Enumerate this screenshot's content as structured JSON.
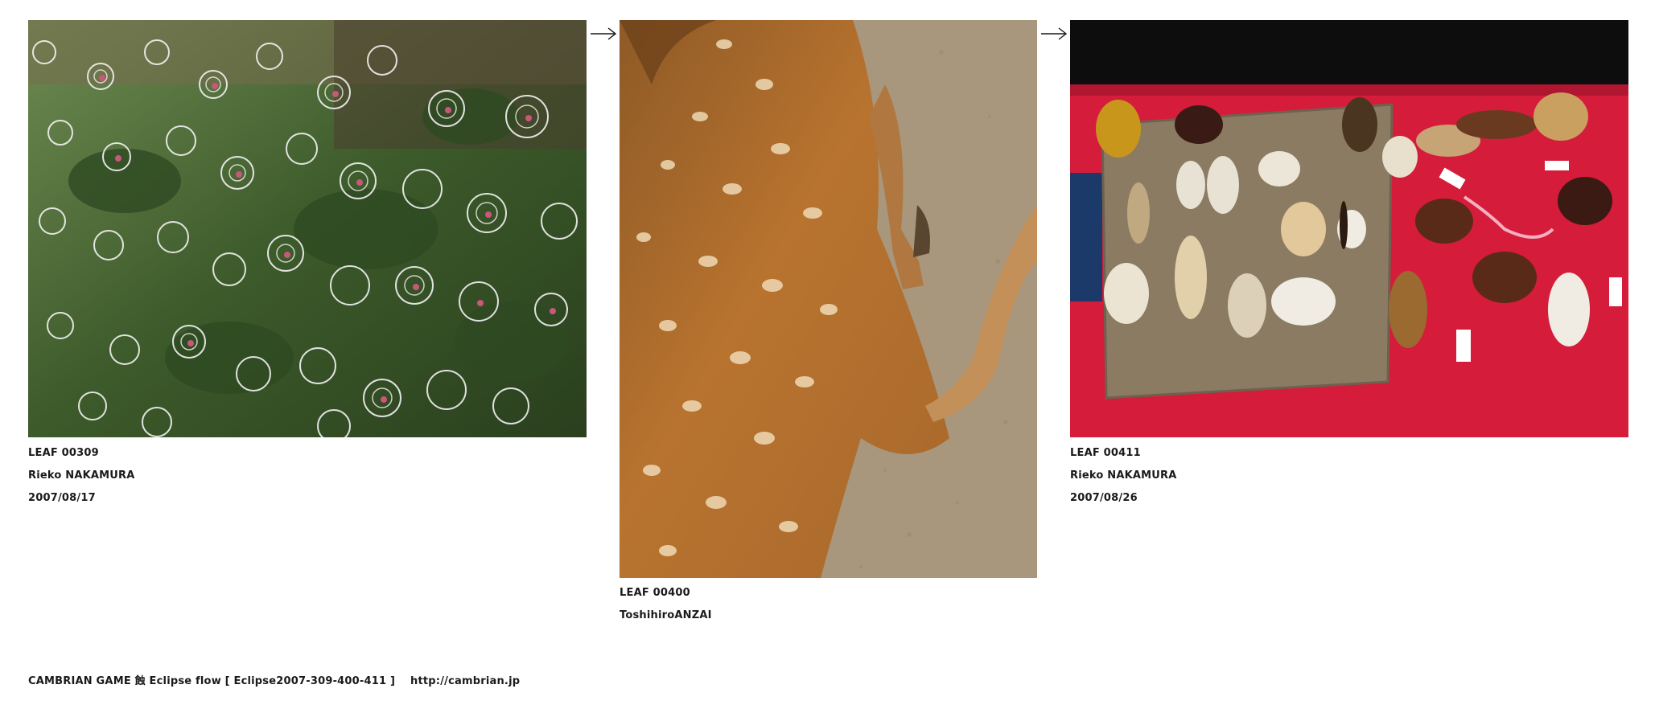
{
  "leaves": [
    {
      "id": "LEAF 00309",
      "author": "Rieko NAKAMURA",
      "date": "2007/08/17"
    },
    {
      "id": "LEAF 00400",
      "author": "ToshihiroANZAI"
    },
    {
      "id": "LEAF 00411",
      "author": "Rieko NAKAMURA",
      "date": "2007/08/26"
    }
  ],
  "arrows": [
    {
      "glyph": "→"
    },
    {
      "glyph": "→"
    }
  ],
  "footer": {
    "text": "CAMBRIAN GAME  蝕 Eclipse  flow [ Eclipse2007-309-400-411 ]",
    "link": "http://cambrian.jp"
  },
  "colors": {
    "text": "#1a1a1a",
    "background": "#ffffff",
    "foliage": "#3f5e2c",
    "deer_fur": "#b8732f",
    "cloth_red": "#d51c3a",
    "burlap": "#8a7b62"
  }
}
